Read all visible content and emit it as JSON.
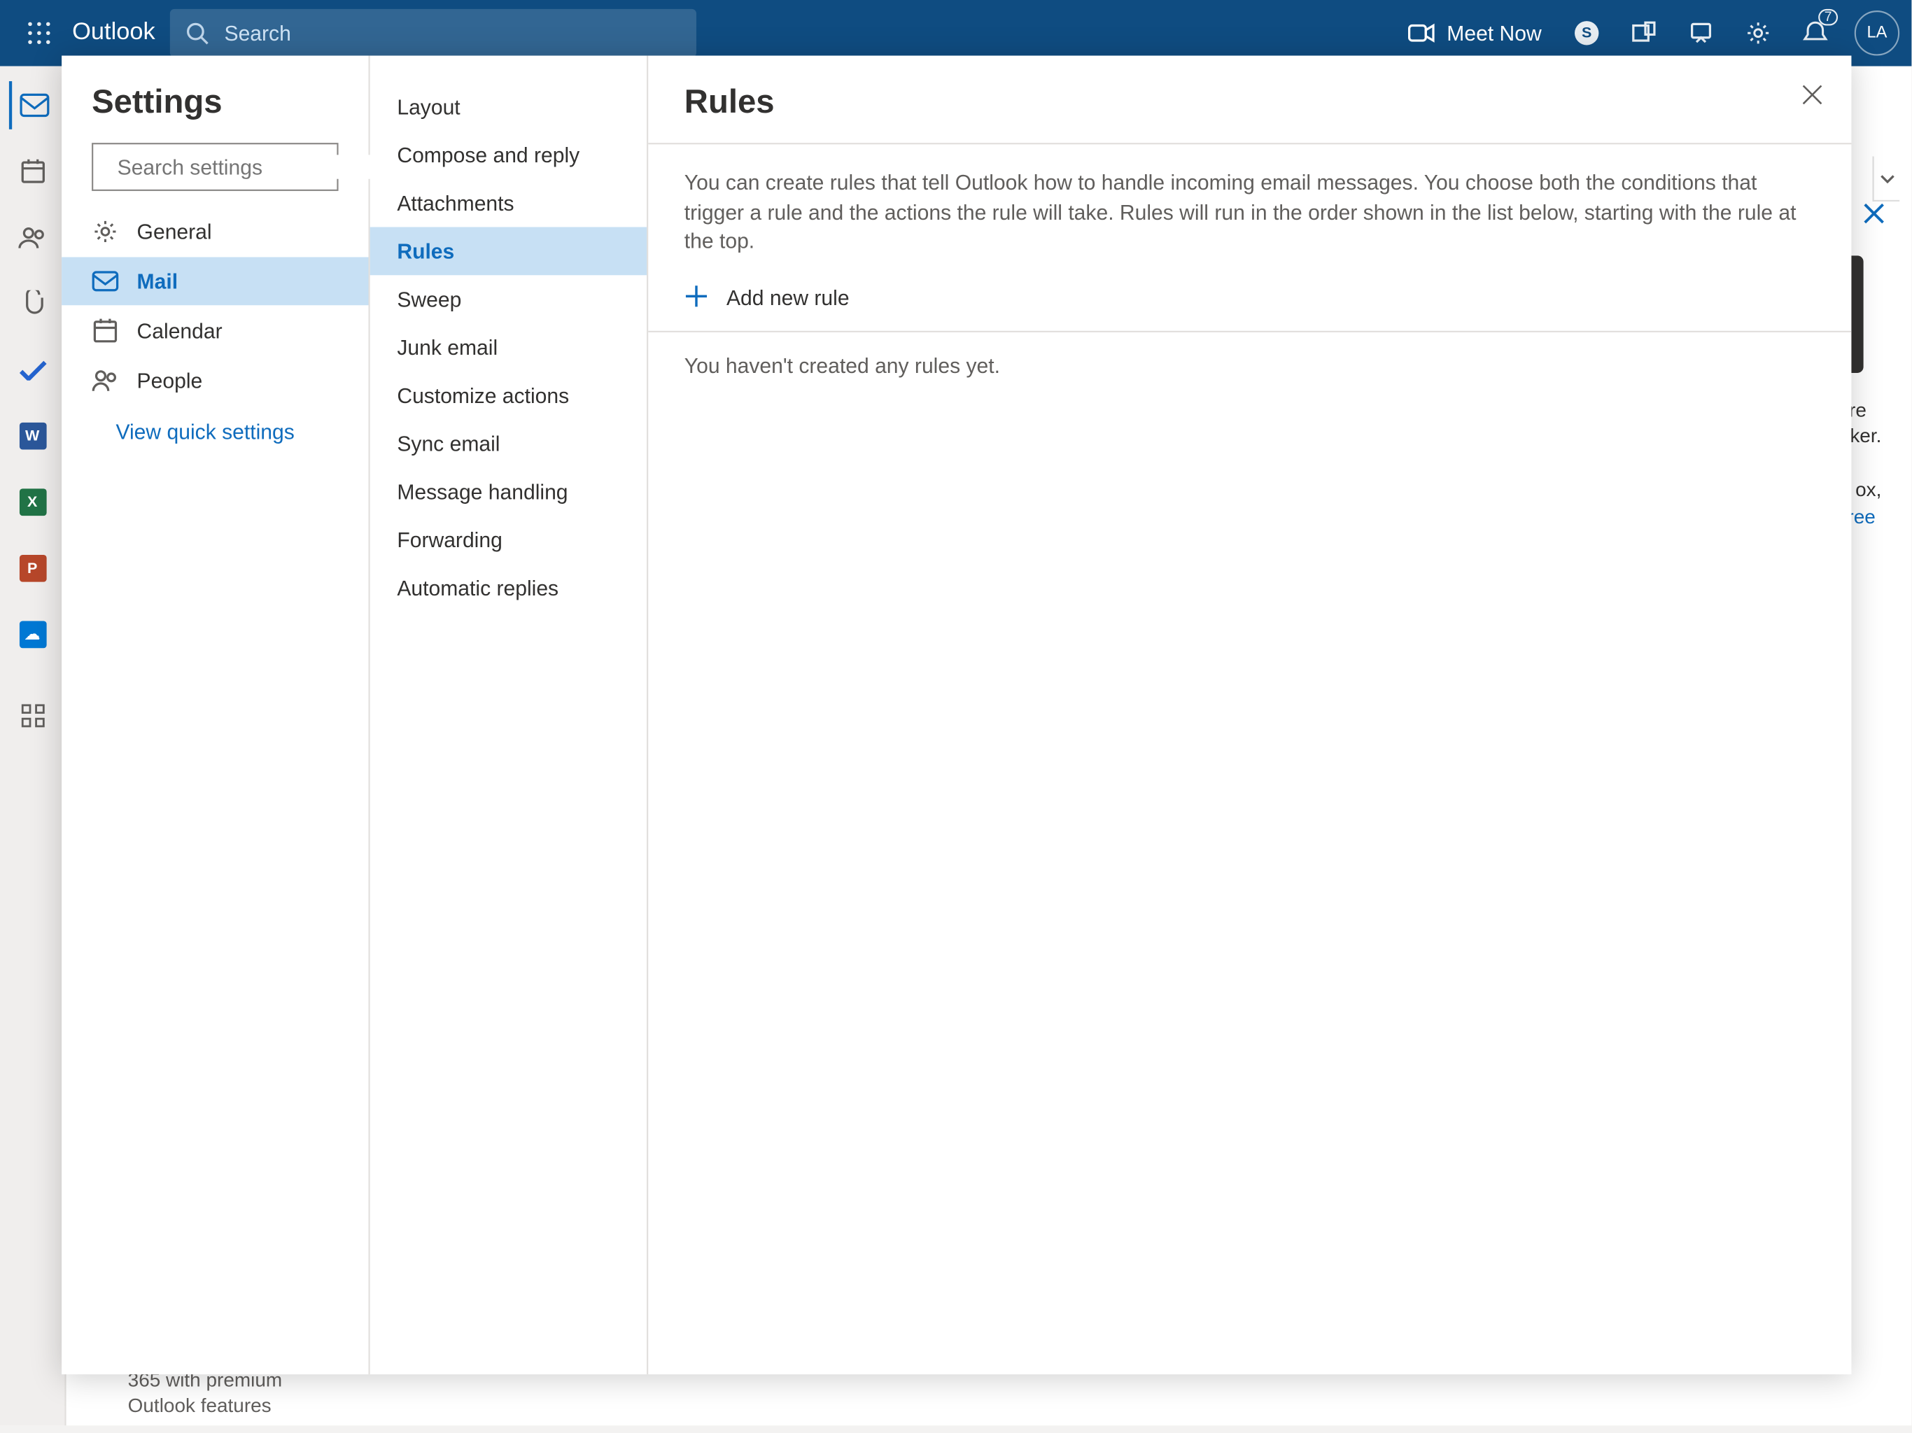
{
  "topbar": {
    "brand": "Outlook",
    "search_placeholder": "Search",
    "meet_now": "Meet Now",
    "notif_count": "7",
    "avatar_initials": "LA"
  },
  "settings": {
    "title": "Settings",
    "search_placeholder": "Search settings",
    "categories": [
      {
        "key": "general",
        "label": "General"
      },
      {
        "key": "mail",
        "label": "Mail"
      },
      {
        "key": "calendar",
        "label": "Calendar"
      },
      {
        "key": "people",
        "label": "People"
      }
    ],
    "quick_link": "View quick settings",
    "mail_subitems": [
      "Layout",
      "Compose and reply",
      "Attachments",
      "Rules",
      "Sweep",
      "Junk email",
      "Customize actions",
      "Sync email",
      "Message handling",
      "Forwarding",
      "Automatic replies"
    ],
    "active_subitem": "Rules"
  },
  "rules": {
    "heading": "Rules",
    "description": "You can create rules that tell Outlook how to handle incoming email messages. You choose both the conditions that trigger a rule and the actions the rule will take. Rules will run in the order shown in the list below, starting with the rule at the top.",
    "add_label": "Add new rule",
    "empty_state": "You haven't created any rules yet."
  },
  "background_scraps": {
    "right1": "re",
    "right2": "ker.",
    "right3": "ox,",
    "right_link": "ree",
    "bottom1": "365 with premium",
    "bottom2": "Outlook features"
  }
}
